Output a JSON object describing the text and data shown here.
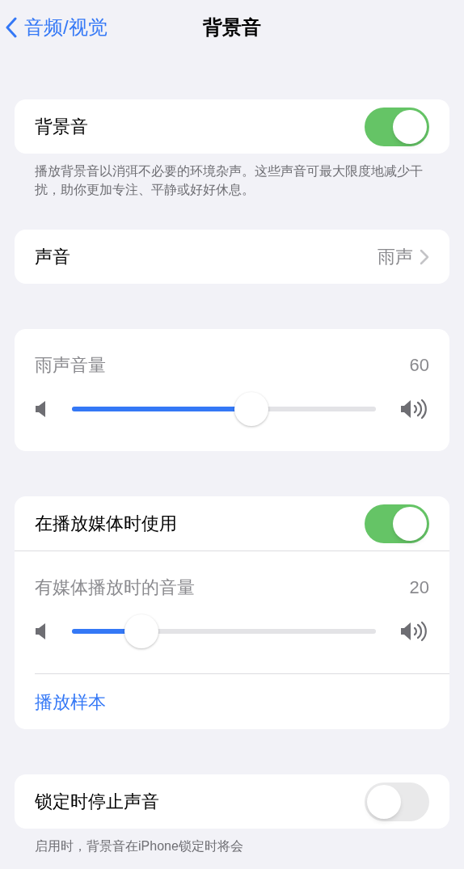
{
  "nav": {
    "back": "音频/视觉",
    "title": "背景音"
  },
  "sections": [
    {
      "rows": [
        {
          "kind": "toggle",
          "label": "背景音",
          "on": true
        }
      ],
      "footer": "播放背景音以消弭不必要的环境杂声。这些声音可最大限度地减少干扰，助你更加专注、平静或好好休息。"
    },
    {
      "rows": [
        {
          "kind": "link",
          "label": "声音",
          "value": "雨声"
        }
      ]
    },
    {
      "rows": [
        {
          "kind": "slider",
          "label": "雨声音量",
          "reading": "60",
          "level": 0.59
        }
      ]
    },
    {
      "rows": [
        {
          "kind": "toggle",
          "label": "在播放媒体时使用",
          "on": true
        },
        {
          "kind": "slider",
          "label": "有媒体播放时的音量",
          "reading": "20",
          "level": 0.23
        },
        {
          "kind": "action",
          "label": "播放样本"
        }
      ]
    },
    {
      "rows": [
        {
          "kind": "toggle",
          "label": "锁定时停止声音",
          "on": false
        }
      ],
      "footer": "启用时，背景音在iPhone锁定时将会"
    }
  ]
}
